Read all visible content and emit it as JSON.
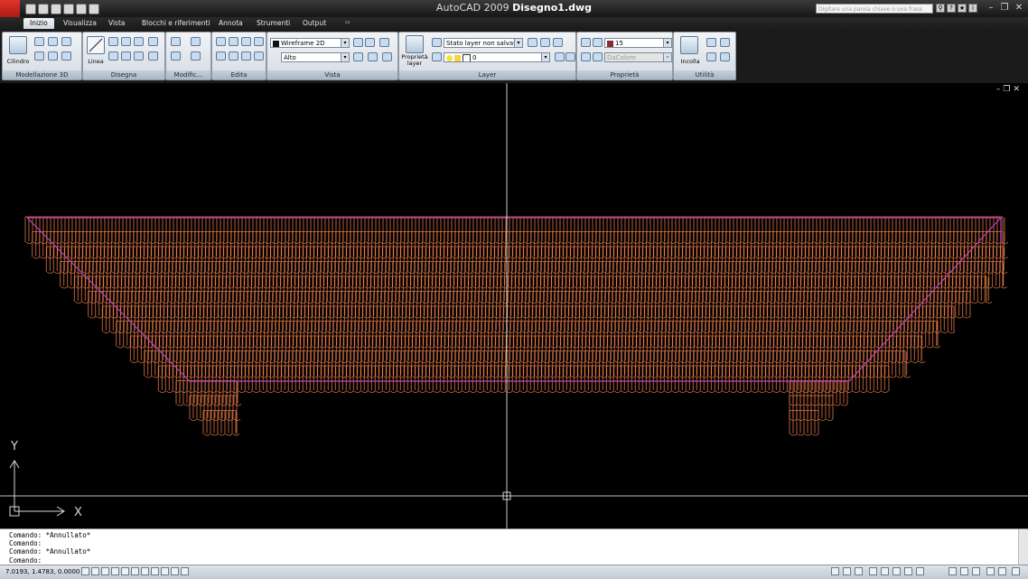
{
  "window": {
    "app_name": "AutoCAD 2009",
    "document_name": "Disegno1.dwg",
    "search_placeholder": "Digitare una parola chiave o una frase"
  },
  "ribbon_tabs": [
    "Inizio",
    "Visualizza",
    "Vista",
    "Blocchi e riferimenti",
    "Annota",
    "Strumenti",
    "Output"
  ],
  "active_tab": "Inizio",
  "panels": {
    "modellazione_3d": {
      "label": "Modellazione 3D",
      "button": "Cilindro"
    },
    "disegna": {
      "label": "Disegna",
      "button": "Linea"
    },
    "modifica": {
      "label": "Modific..."
    },
    "edita": {
      "label": "Edita"
    },
    "vista": {
      "label": "Vista",
      "visual_style": "Wireframe 2D",
      "view": "Alto"
    },
    "layer": {
      "label": "Layer",
      "button_line1": "Proprietà",
      "button_line2": "layer",
      "layer_state": "Stato layer non salvat",
      "current_layer": "0"
    },
    "proprieta": {
      "label": "Proprietà",
      "color": "15",
      "linetype": "DaColore",
      "color_hex": "#8a2b2b"
    },
    "utilita": {
      "label": "Utilità",
      "button": "Incolla"
    }
  },
  "viewport": {
    "axis_x_label": "X",
    "axis_y_label": "Y",
    "background": "#000000",
    "tile_color": "#e07848",
    "outline_color": "#c040c0",
    "crosshair_color": "#ffffff"
  },
  "command_history": [
    "Comando: *Annullato*",
    "Comando:",
    "Comando: *Annullato*",
    "Comando:"
  ],
  "status": {
    "coordinates": "7.0193, 1.4783, 0.0000"
  }
}
